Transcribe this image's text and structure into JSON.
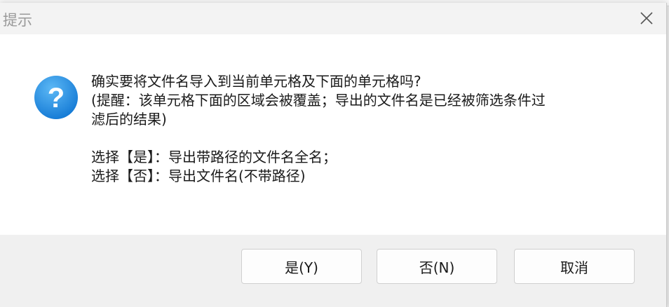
{
  "dialog": {
    "title": "提示",
    "close_icon": "close-icon",
    "icon": "question-icon",
    "icon_color": "#1e8ee8",
    "message": {
      "line1": "确实要将文件名导入到当前单元格及下面的单元格吗?",
      "line2": "(提醒：该单元格下面的区域会被覆盖；导出的文件名是已经被筛选条件过",
      "line3": "滤后的结果)",
      "line4": "选择【是】：导出带路径的文件名全名；",
      "line5": "选择【否】：导出文件名(不带路径)"
    },
    "buttons": {
      "yes": "是(Y)",
      "no": "否(N)",
      "cancel": "取消"
    }
  }
}
